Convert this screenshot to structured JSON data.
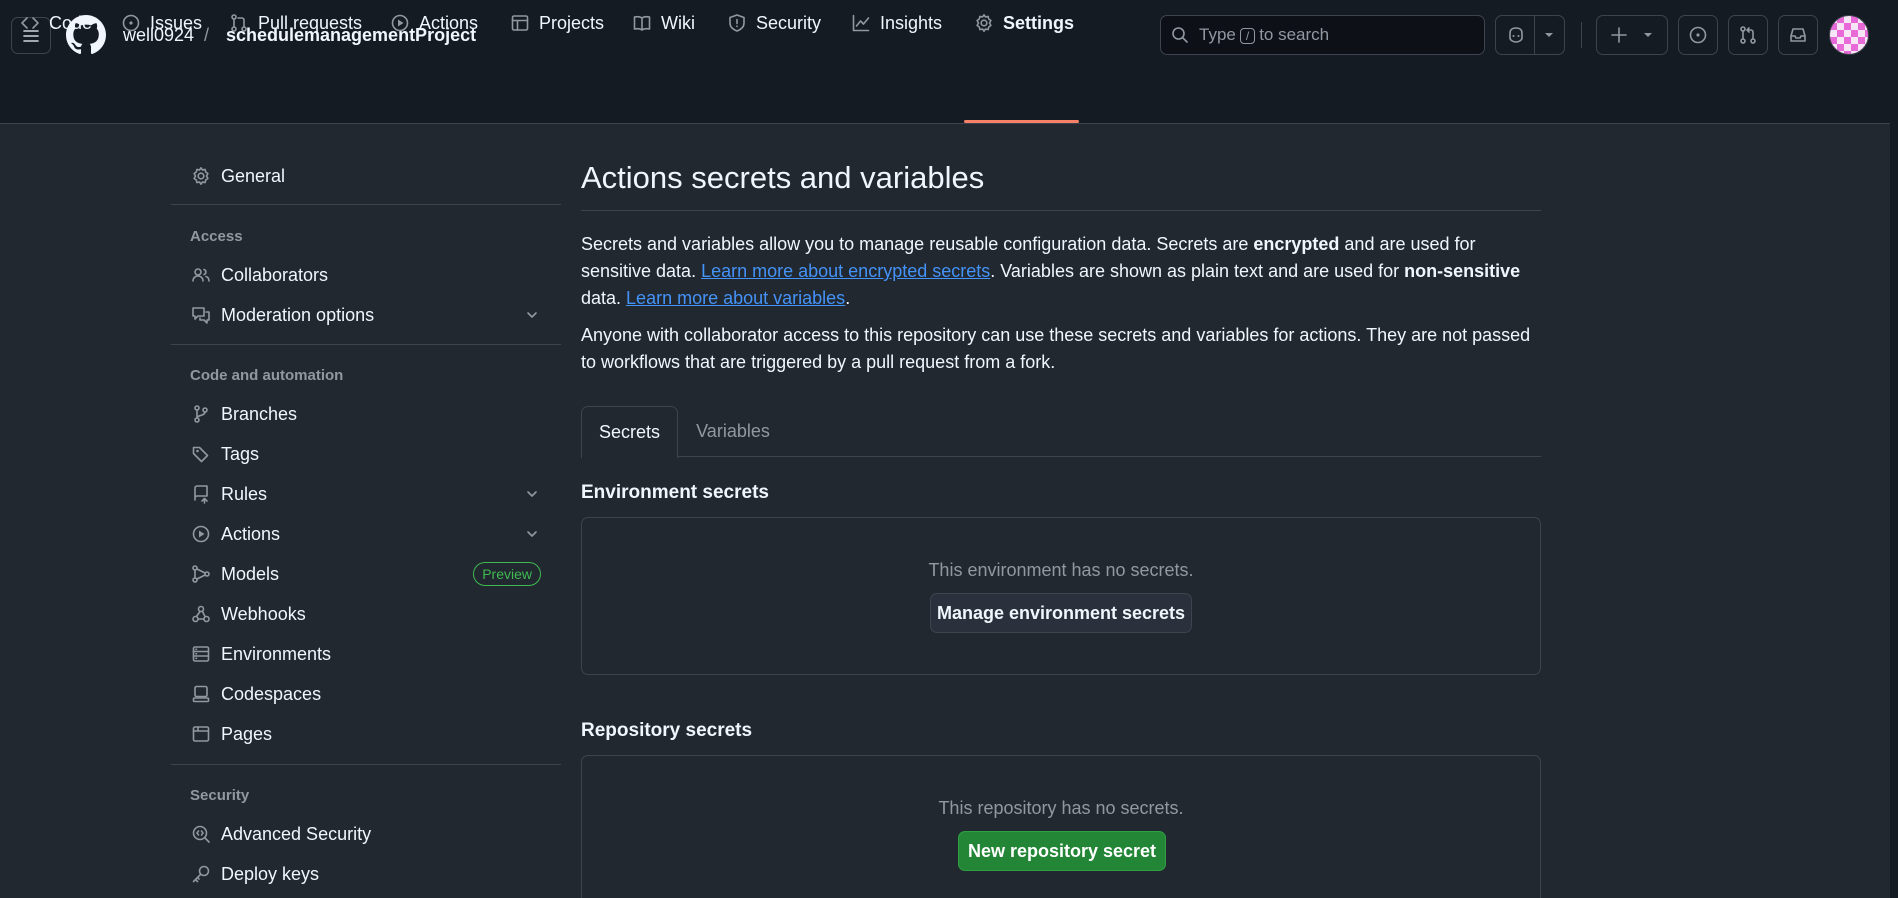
{
  "header": {
    "owner": "well0924",
    "separator": "/",
    "repo": "schedulemanagementProject",
    "search": {
      "prefix": "Type",
      "key": "/",
      "suffix": "to search"
    }
  },
  "repo_nav": [
    {
      "label": "Code",
      "icon": "code-icon"
    },
    {
      "label": "Issues",
      "icon": "issue-opened-icon"
    },
    {
      "label": "Pull requests",
      "icon": "git-pull-request-icon"
    },
    {
      "label": "Actions",
      "icon": "play-icon"
    },
    {
      "label": "Projects",
      "icon": "table-icon"
    },
    {
      "label": "Wiki",
      "icon": "book-icon"
    },
    {
      "label": "Security",
      "icon": "shield-icon"
    },
    {
      "label": "Insights",
      "icon": "graph-icon"
    },
    {
      "label": "Settings",
      "icon": "gear-icon",
      "active": true
    }
  ],
  "sidebar": {
    "general": "General",
    "access_heading": "Access",
    "access": [
      {
        "label": "Collaborators",
        "icon": "people-icon"
      },
      {
        "label": "Moderation options",
        "icon": "comment-discussion-icon",
        "expandable": true
      }
    ],
    "automation_heading": "Code and automation",
    "automation": [
      {
        "label": "Branches",
        "icon": "git-branch-icon"
      },
      {
        "label": "Tags",
        "icon": "tag-icon"
      },
      {
        "label": "Rules",
        "icon": "repo-push-icon",
        "expandable": true
      },
      {
        "label": "Actions",
        "icon": "play-icon",
        "expandable": true
      },
      {
        "label": "Models",
        "icon": "ai-model-icon",
        "badge": "Preview"
      },
      {
        "label": "Webhooks",
        "icon": "webhook-icon"
      },
      {
        "label": "Environments",
        "icon": "server-icon"
      },
      {
        "label": "Codespaces",
        "icon": "codespaces-icon"
      },
      {
        "label": "Pages",
        "icon": "browser-icon"
      }
    ],
    "security_heading": "Security",
    "security": [
      {
        "label": "Advanced Security",
        "icon": "codescan-icon"
      },
      {
        "label": "Deploy keys",
        "icon": "key-icon"
      }
    ]
  },
  "main": {
    "title": "Actions secrets and variables",
    "intro": {
      "t1": "Secrets and variables allow you to manage reusable configuration data. Secrets are ",
      "b1": "encrypted",
      "t2": " and are used for sensitive data. ",
      "link1": "Learn more about encrypted secrets",
      "t3": ". Variables are shown as plain text and are used for ",
      "b2": "non-sensitive",
      "t4": " data. ",
      "link2": "Learn more about variables",
      "t5": "."
    },
    "access_note": "Anyone with collaborator access to this repository can use these secrets and variables for actions. They are not passed to workflows that are triggered by a pull request from a fork.",
    "tabs": [
      "Secrets",
      "Variables"
    ],
    "env_secrets": {
      "title": "Environment secrets",
      "empty": "This environment has no secrets.",
      "button": "Manage environment secrets"
    },
    "repo_secrets": {
      "title": "Repository secrets",
      "empty": "This repository has no secrets.",
      "button": "New repository secret"
    }
  },
  "colors": {
    "background": "#212830",
    "header": "#151b23",
    "accent_link": "#4493f8",
    "primary_button": "#238636",
    "active_tab_underline": "#f78166",
    "preview_badge": "#3fb950"
  }
}
